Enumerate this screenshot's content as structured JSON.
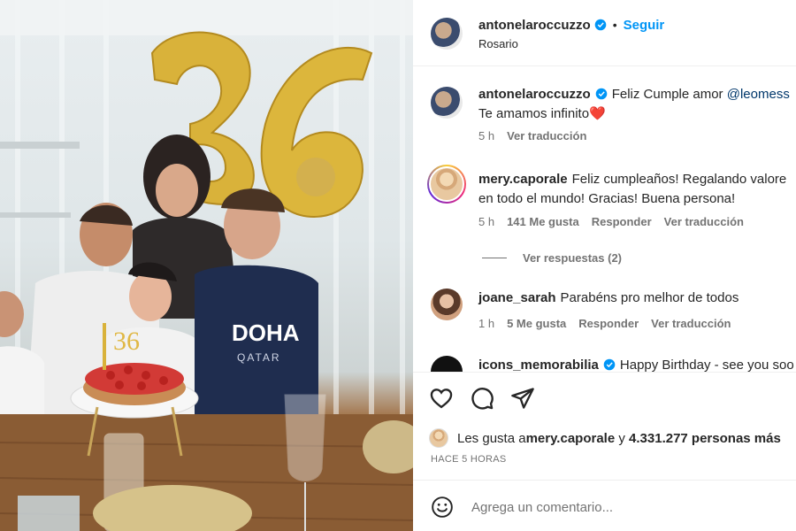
{
  "post": {
    "author": "antonelaroccuzzo",
    "follow_label": "Seguir",
    "location": "Rosario"
  },
  "comments": [
    {
      "user": "antonelaroccuzzo",
      "text_before": "Feliz Cumple amor ",
      "mention": "@leomess",
      "line2": "Te amamos infinito",
      "heart": "❤️",
      "time": "5 h",
      "translate": "Ver traducción"
    },
    {
      "user": "mery.caporale",
      "text": "Feliz cumpleaños! Regalando valore",
      "line2": "en todo el mundo! Gracias! Buena persona!",
      "time": "5 h",
      "likes": "141 Me gusta",
      "reply": "Responder",
      "translate": "Ver traducción",
      "replies": "Ver respuestas (2)"
    },
    {
      "user": "joane_sarah",
      "text": "Parabéns pro melhor de todos",
      "time": "1 h",
      "likes": "5 Me gusta",
      "reply": "Responder",
      "translate": "Ver traducción"
    },
    {
      "user": "icons_memorabilia",
      "text": "Happy Birthday - see you soo"
    }
  ],
  "likes_line": {
    "prefix": "Les gusta a ",
    "user": "mery.caporale",
    "mid": " y ",
    "count": "4.331.277 personas más"
  },
  "time_ago": "HACE 5 HORAS",
  "comment_input": {
    "placeholder": "Agrega un comentario..."
  },
  "photo": {
    "balloon": "36",
    "cake_topper": "36",
    "shirt_text_1": "DOHA",
    "shirt_text_2": "QATAR"
  },
  "colors": {
    "accent": "#0095f6",
    "verified": "#0095f6",
    "heart": "#ed4956"
  },
  "icons": [
    "verified-badge-icon",
    "heart-icon",
    "comment-icon",
    "share-icon",
    "emoji-icon"
  ]
}
